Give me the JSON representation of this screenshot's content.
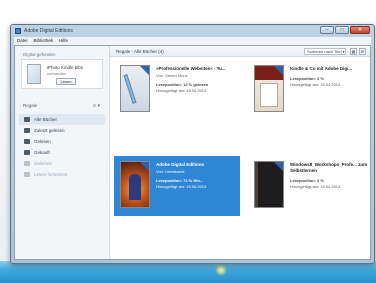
{
  "window": {
    "title": "Adobe Digital Editions",
    "min_glyph": "–",
    "max_glyph": "□",
    "close_glyph": "✕"
  },
  "menu": [
    "Datei",
    "Bibliothek",
    "Hilfe"
  ],
  "sidebar": {
    "device_label": "Digital gefunden",
    "device_name": "iPhoto Kindle bibs",
    "device_status": "verbunden",
    "device_button": "Lesen",
    "library_label": "Regale",
    "library_tools": "≡ ▾",
    "items": [
      {
        "label": "Alle Bücher",
        "selected": true,
        "faded": false
      },
      {
        "label": "Zuletzt gelesen",
        "selected": false,
        "faded": false
      },
      {
        "label": "Gelesen",
        "selected": false,
        "faded": false
      },
      {
        "label": "Gekauft",
        "selected": false,
        "faded": false
      },
      {
        "label": "Geliehen",
        "selected": false,
        "faded": true
      },
      {
        "label": "Lesen fortsetzen",
        "selected": false,
        "faded": true
      }
    ]
  },
  "main": {
    "title": "Regale - Alle Bücher (4)",
    "sort_label": "Sortieren nach Titel ▾",
    "view_buttons": [
      "▦",
      "☰"
    ],
    "books": [
      {
        "title": "»Professionelle Websites« - Tu...",
        "author": "Von: Stefan Münz",
        "line1": "Leseposition: 12 % gelesen",
        "line2": "Hinzugefügt am: 15.04.2013",
        "selected": false
      },
      {
        "title": "Kindle & Co mit Adobe Digi...",
        "author": "",
        "line1": "Leseposition: 2 %",
        "line2": "Hinzugefügt am: 15.04.2013",
        "selected": false
      },
      {
        "title": "Adobe Digital Editions",
        "author": "Von: Unbekannt",
        "line1": "Leseposition: 71 % Hin...",
        "line2": "Hinzugefügt am: 15.04.2013",
        "selected": true
      },
      {
        "title": "Windows8_Workshops_Profe... zum Selbstlernen",
        "author": "",
        "line1": "Leseposition: 0 %",
        "line2": "Hinzugefügt am: 15.04.2013",
        "selected": false
      }
    ]
  }
}
